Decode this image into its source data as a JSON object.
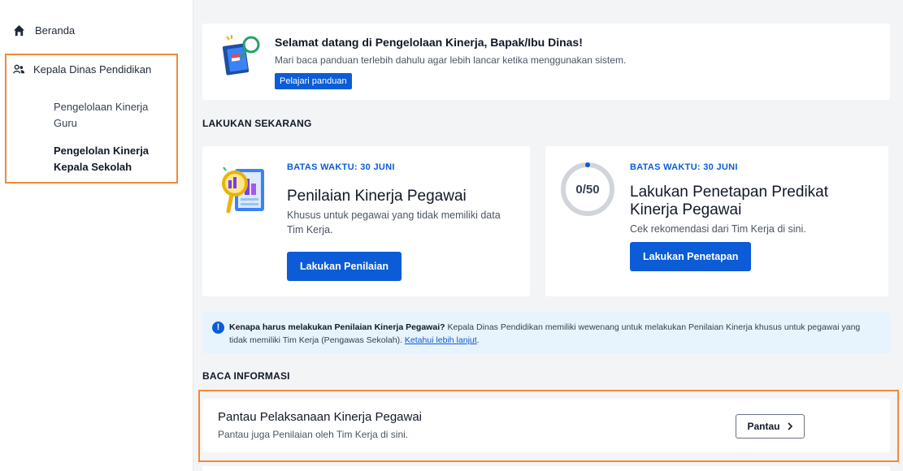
{
  "sidebar": {
    "home": "Beranda",
    "role": "Kepala Dinas Pendidikan",
    "items": [
      {
        "label": "Pengelolaan Kinerja Guru"
      },
      {
        "label": "Pengelolan Kinerja Kepala Sekolah"
      }
    ]
  },
  "welcome": {
    "title": "Selamat datang di Pengelolaan Kinerja, Bapak/Ibu Dinas!",
    "text": "Mari baca panduan terlebih dahulu agar lebih lancar ketika menggunakan sistem.",
    "button": "Pelajari panduan"
  },
  "section_now": "LAKUKAN SEKARANG",
  "task1": {
    "deadline": "BATAS WAKTU: 30 JUNI",
    "title": "Penilaian Kinerja Pegawai",
    "desc": "Khusus untuk pegawai yang tidak memiliki data Tim Kerja.",
    "button": "Lakukan Penilaian"
  },
  "task2": {
    "progress_text": "0/50",
    "progress_value": 0,
    "progress_total": 50,
    "deadline": "BATAS WAKTU: 30 JUNI",
    "title": "Lakukan Penetapan Predikat Kinerja Pegawai",
    "desc": "Cek rekomendasi dari Tim Kerja di sini.",
    "button": "Lakukan Penetapan"
  },
  "info": {
    "bold": "Kenapa harus melakukan Penilaian Kinerja Pegawai?",
    "text": " Kepala Dinas Pendidikan memiliki wewenang untuk melakukan Penilaian Kinerja khusus untuk pegawai yang tidak memiliki Tim Kerja (Pengawas Sekolah). ",
    "link": "Ketahui lebih lanjut",
    "end": "."
  },
  "section_info": "BACA INFORMASI",
  "monitor": {
    "title": "Pantau Pelaksanaan Kinerja Pegawai",
    "desc": "Pantau juga Penilaian oleh Tim Kerja di sini.",
    "button": "Pantau",
    "button_icon": "chevron-right-icon"
  },
  "colors": {
    "accent": "#0b5cd6",
    "highlight": "#f08a3a",
    "info_bg": "#e7f3fd"
  }
}
